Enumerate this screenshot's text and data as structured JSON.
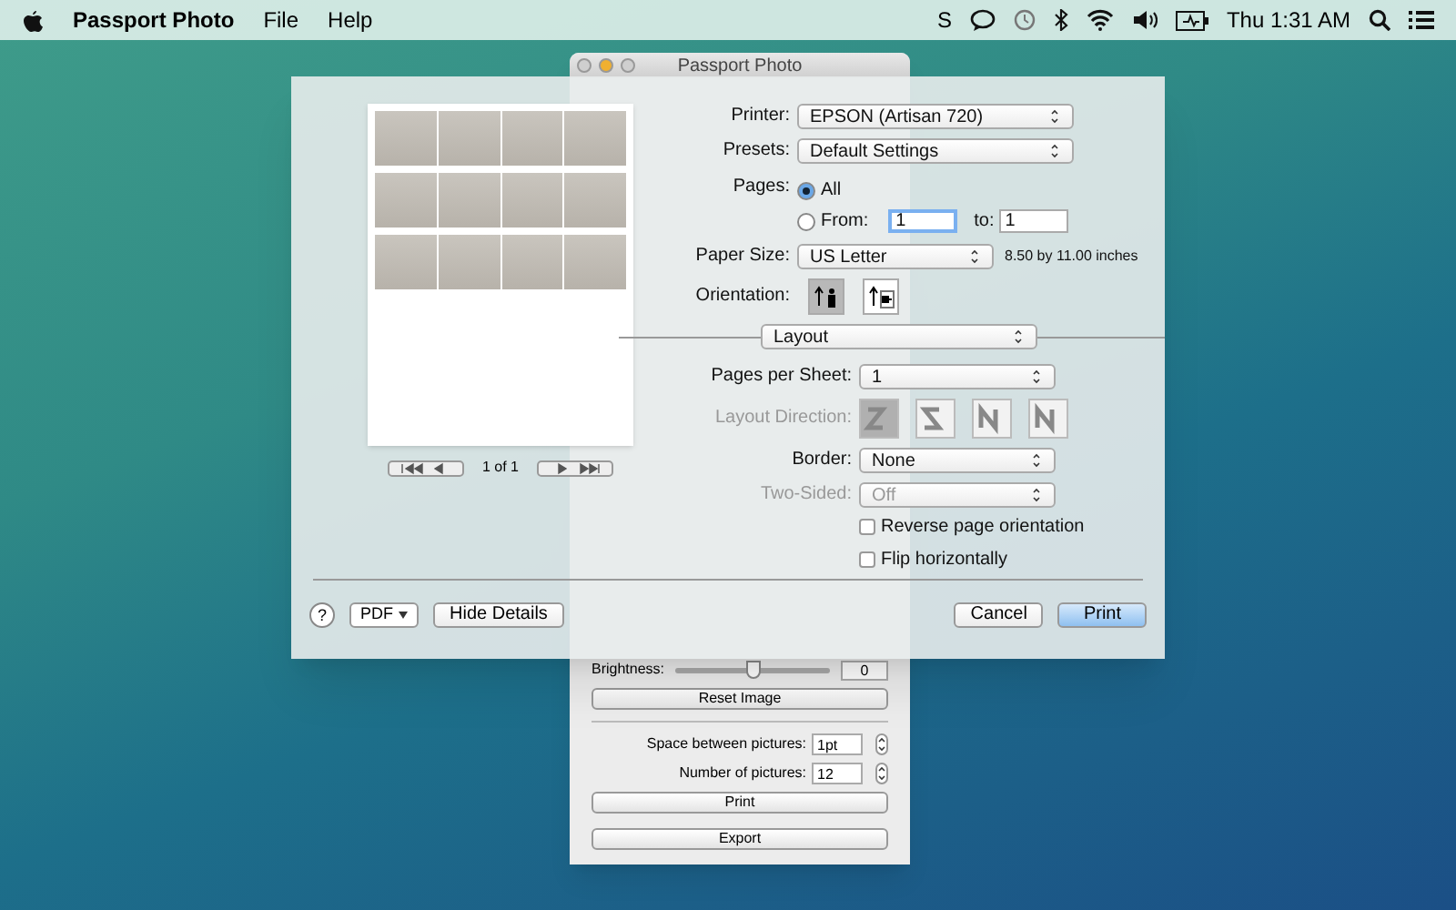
{
  "menubar": {
    "app_name": "Passport Photo",
    "menus": [
      "File",
      "Help"
    ],
    "status_letter": "S",
    "clock": "Thu 1:31 AM"
  },
  "app_window": {
    "title": "Passport Photo",
    "brightness": {
      "label": "Brightness:",
      "value": "0",
      "level": 0.5
    },
    "reset_button": "Reset Image",
    "spacing": {
      "label": "Space between pictures:",
      "value": "1pt"
    },
    "count": {
      "label": "Number of pictures:",
      "value": "12"
    },
    "print_button": "Print",
    "export_button": "Export"
  },
  "print_sheet": {
    "page_indicator": "1 of 1",
    "printer": {
      "label": "Printer:",
      "value": "EPSON (Artisan 720)"
    },
    "presets": {
      "label": "Presets:",
      "value": "Default Settings"
    },
    "pages": {
      "label": "Pages:",
      "options": [
        {
          "label": "All",
          "selected": true
        },
        {
          "label": "From:",
          "selected": false
        }
      ],
      "from_value": "1",
      "to_label": "to:",
      "to_value": "1"
    },
    "paper_size": {
      "label": "Paper Size:",
      "value": "US Letter",
      "dimensions": "8.50 by 11.00 inches"
    },
    "orientation": {
      "label": "Orientation:",
      "options": [
        {
          "kind": "portrait",
          "selected": true
        },
        {
          "kind": "landscape",
          "selected": false
        }
      ]
    },
    "section": "Layout",
    "pages_per_sheet": {
      "label": "Pages per Sheet:",
      "value": "1"
    },
    "layout_direction": {
      "label": "Layout Direction:",
      "disabled": true,
      "options": [
        {
          "selected": true
        },
        {
          "selected": false
        },
        {
          "selected": false
        },
        {
          "selected": false
        }
      ]
    },
    "border": {
      "label": "Border:",
      "value": "None"
    },
    "two_sided": {
      "label": "Two-Sided:",
      "value": "Off",
      "disabled": true
    },
    "checkboxes": [
      {
        "label": "Reverse page orientation",
        "checked": false
      },
      {
        "label": "Flip horizontally",
        "checked": false
      }
    ],
    "help": "?",
    "pdf_button": "PDF",
    "hide_details": "Hide Details",
    "cancel": "Cancel",
    "print": "Print"
  }
}
